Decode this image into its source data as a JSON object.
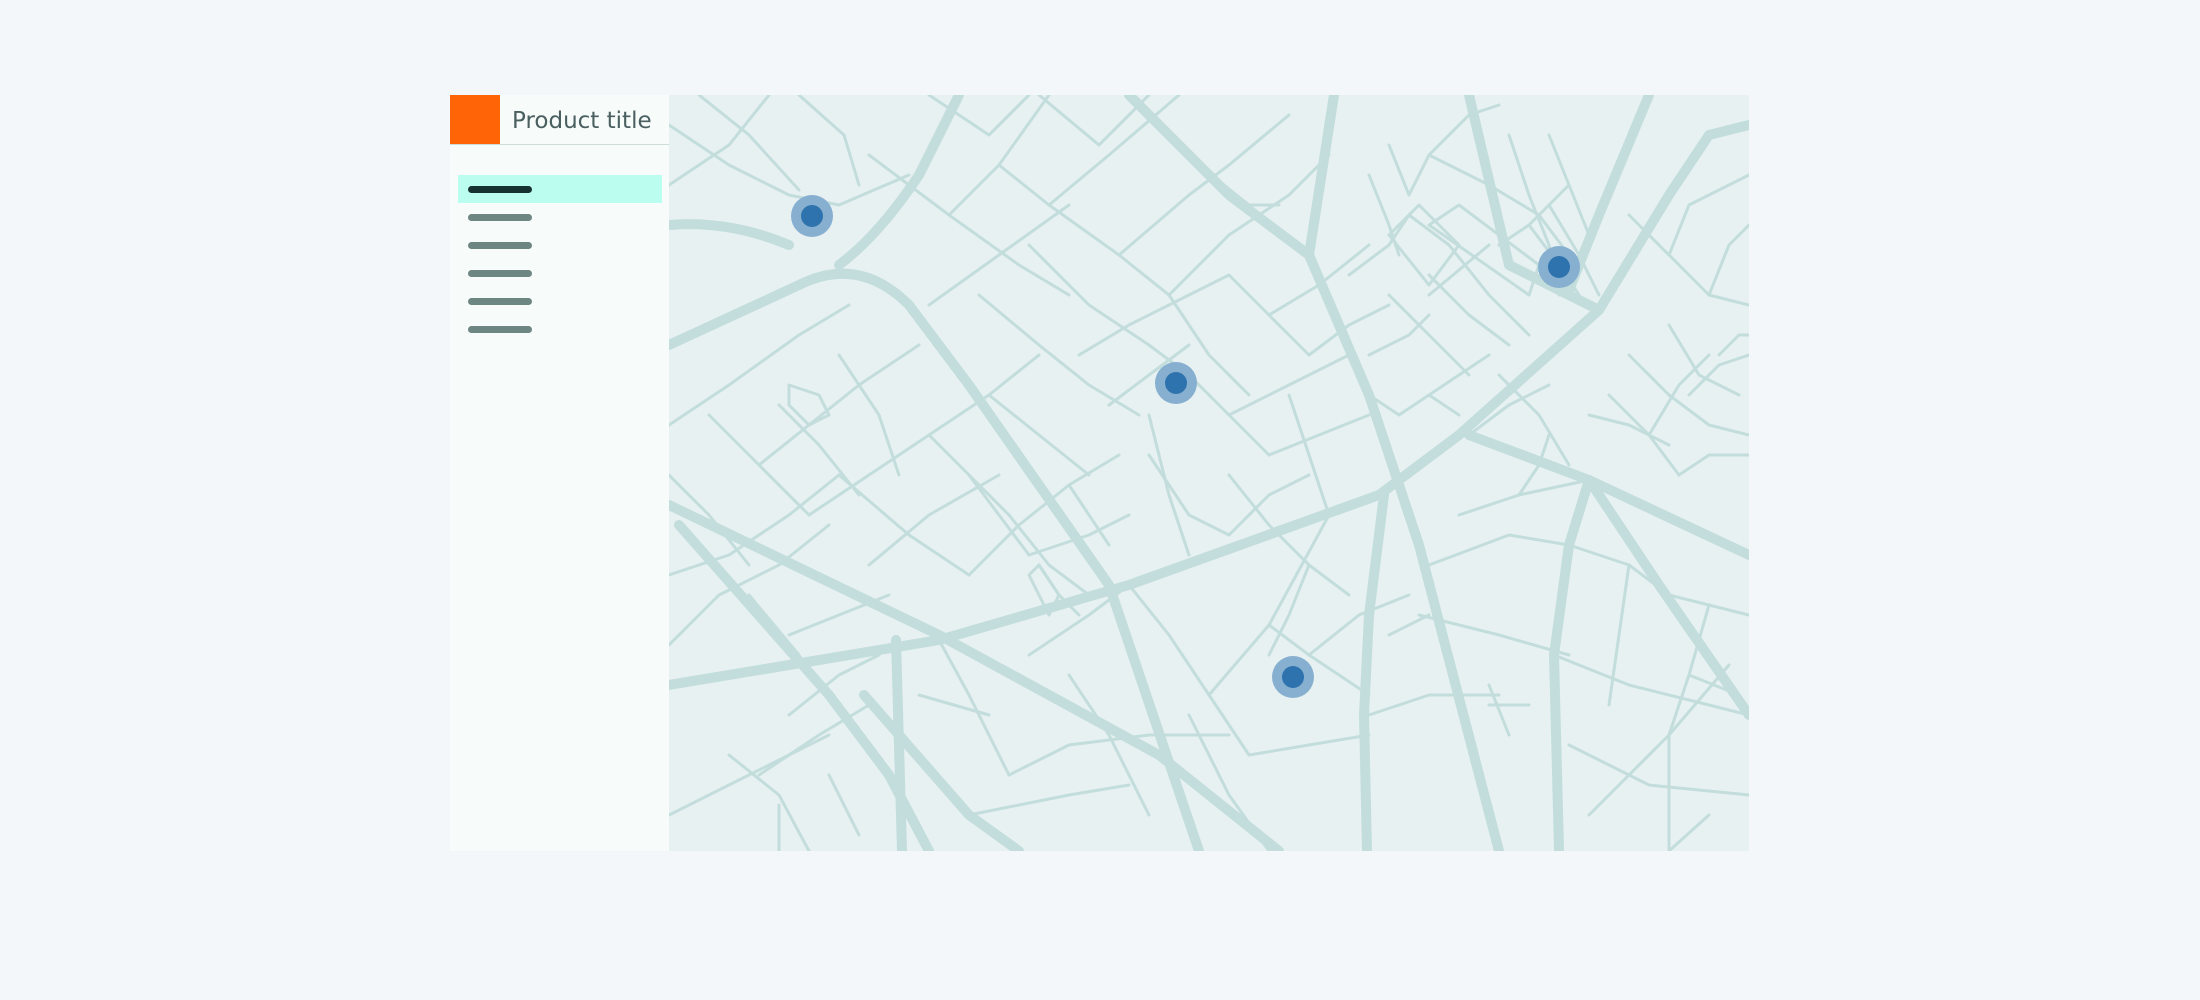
{
  "header": {
    "title": "Product title"
  },
  "sidebar": {
    "selected_index": 0,
    "items": [
      {
        "name": "nav-item-1"
      },
      {
        "name": "nav-item-2"
      },
      {
        "name": "nav-item-3"
      },
      {
        "name": "nav-item-4"
      },
      {
        "name": "nav-item-5"
      },
      {
        "name": "nav-item-6"
      }
    ]
  },
  "colors": {
    "logo": "#ff6407",
    "selected_item": "#bbfdef",
    "map_background": "#e7f1f1",
    "roads": "#c2dcdc",
    "marker": "#2e73ad",
    "marker_halo": "#86afd0"
  },
  "map": {
    "markers": [
      {
        "name": "map-marker-1"
      },
      {
        "name": "map-marker-2"
      },
      {
        "name": "map-marker-3"
      },
      {
        "name": "map-marker-4"
      }
    ]
  }
}
